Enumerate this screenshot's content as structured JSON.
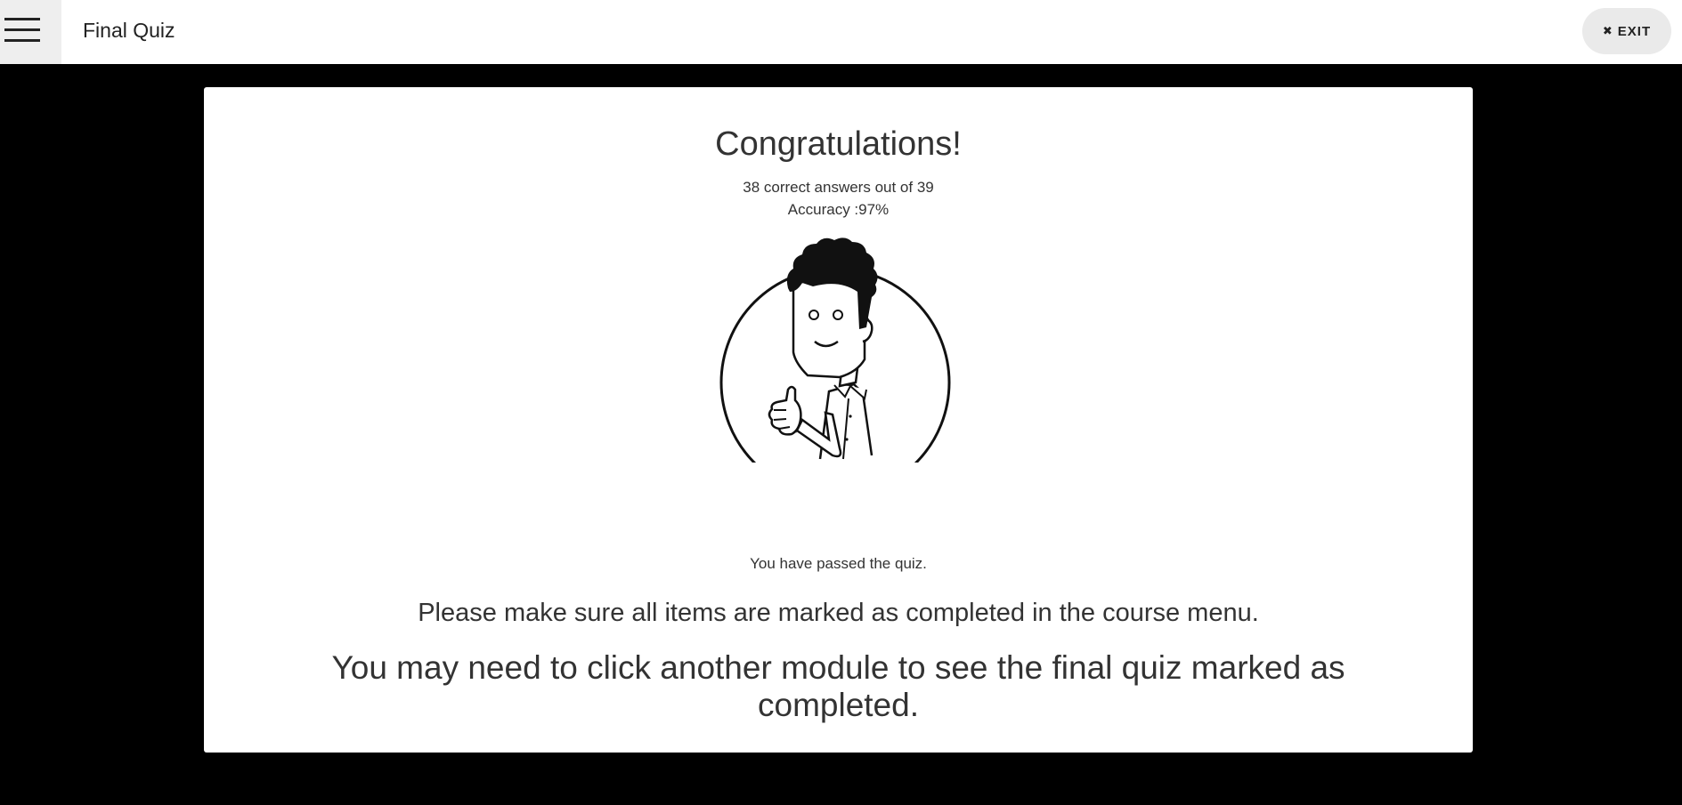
{
  "header": {
    "menu_icon": "hamburger-menu-icon",
    "title": "Final Quiz",
    "exit_icon": "close-icon",
    "exit_label": "EXIT"
  },
  "result": {
    "heading": "Congratulations!",
    "score_line": "38 correct answers out of 39",
    "accuracy_line": "Accuracy :97%",
    "illustration": "thumbs-up-character-illustration",
    "passed_message": "You have passed the quiz.",
    "reminder": "Please make sure all items are marked as completed in the course menu.",
    "note": "You may need to click another module to see the final quiz marked as completed."
  },
  "colors": {
    "background": "#000000",
    "card": "#ffffff",
    "text": "#333333",
    "menu_button_bg": "#eeeeee",
    "exit_button_bg": "#eaeaea"
  }
}
